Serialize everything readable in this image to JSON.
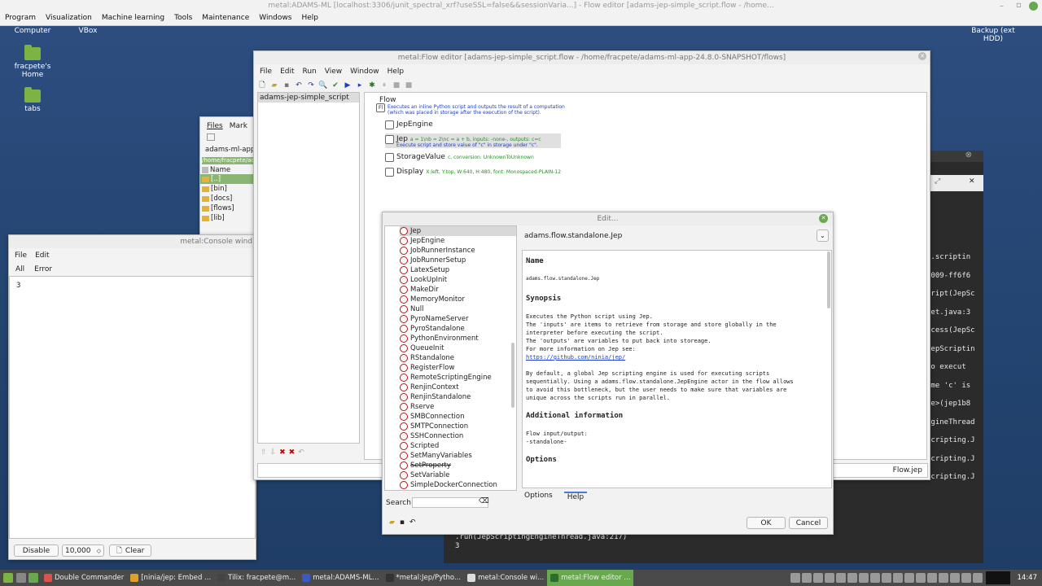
{
  "appbar": {
    "title": "metal:ADAMS-ML [localhost:3306/junit_spectral_xrf?useSSL=false&&sessionVaria...] - Flow editor [adams-jep-simple_script.flow - /home...",
    "menu": [
      "Program",
      "Visualization",
      "Machine learning",
      "Tools",
      "Maintenance",
      "Windows",
      "Help"
    ]
  },
  "desktop": {
    "computer": "Computer",
    "vbox": "VBox",
    "backup": "Backup (ext",
    "backup2": "HDD)",
    "home_line1": "fracpete's",
    "home_line2": "Home",
    "tabs": "tabs"
  },
  "console": {
    "title": "metal:Console wind",
    "menu": [
      "File",
      "Edit"
    ],
    "tabs": [
      "All",
      "Error"
    ],
    "content": "3",
    "disable": "Disable",
    "spinner": "10,000",
    "clear": "Clear"
  },
  "filesmgr": {
    "tabs": [
      "Files",
      "Mark"
    ],
    "path_label": "adams-ml-app-2",
    "path_field": "/home/fracpete/ad",
    "name_header": "Name",
    "items": [
      "[..]",
      "[bin]",
      "[docs]",
      "[flows]",
      "[lib]"
    ]
  },
  "flow": {
    "title": "metal:Flow editor [adams-jep-simple_script.flow - /home/fracpete/adams-ml-app-24.8.0-SNAPSHOT/flows]",
    "menu": [
      "File",
      "Edit",
      "Run",
      "View",
      "Window",
      "Help"
    ],
    "tab": "adams-jep-simple_script",
    "root_label": "Flow",
    "root_desc1": "Executes an inline Python script and outputs the result of a computation",
    "root_desc2": "(which was placed in storage after the execution of the script).",
    "nodes": [
      {
        "name": "JepEngine",
        "icon": "jep",
        "desc1": "",
        "desc2": ""
      },
      {
        "name": "Jep",
        "icon": "jep",
        "desc1": "a = 1\\nb = 2\\nc = a + b, inputs: -none-, outputs: c=c",
        "desc2": "Execute script and store value of \"c\" in storage under \"c\"."
      },
      {
        "name": "StorageValue",
        "icon": "sv",
        "desc1": "c, conversion: UnknownToUnknown",
        "desc2": ""
      },
      {
        "name": "Display",
        "icon": "disp",
        "desc1": "X:left, Y:top, W:640, H:480, font: Monospaced-PLAIN-12",
        "desc2": ""
      }
    ],
    "status": "Flow.jep"
  },
  "edit": {
    "title": "Edit...",
    "class": "adams.flow.standalone.Jep",
    "actors": [
      "Jep",
      "JepEngine",
      "JobRunnerInstance",
      "JobRunnerSetup",
      "LatexSetup",
      "LookUpInit",
      "MakeDir",
      "MemoryMonitor",
      "Null",
      "PyroNameServer",
      "PyroStandalone",
      "PythonEnvironment",
      "QueueInit",
      "RStandalone",
      "RegisterFlow",
      "RemoteScriptingEngine",
      "RenjinContext",
      "RenjinStandalone",
      "Rserve",
      "SMBConnection",
      "SMTPConnection",
      "SSHConnection",
      "Scripted",
      "SetManyVariables",
      "SetProperty",
      "SetVariable",
      "SimpleDockerConnection"
    ],
    "search_label": "Search",
    "help_name_h": "Name",
    "help_name": "adams.flow.standalone.Jep",
    "help_syn_h": "Synopsis",
    "help_syn": [
      "Executes the Python script using Jep.",
      "The 'inputs' are items to retrieve from storage and store globally in the",
      "interpreter before executing the script.",
      "The 'outputs' are variables to put back into storeage.",
      "For more information on Jep see:"
    ],
    "help_link": "https://github.com/ninia/jep/",
    "help_default": [
      "By default, a global Jep scripting engine is used for executing scripts",
      "sequentially. Using a adams.flow.standalone.JepEngine actor in the flow allows",
      "to avoid this bottleneck, but the user needs to make sure that variables are",
      "unique across the scripts run in parallel."
    ],
    "help_add_h": "Additional information",
    "help_add": [
      "Flow input/output:",
      "-standalone-"
    ],
    "help_opt_h": "Options",
    "tabs": [
      "Options",
      "Help"
    ],
    "ok": "OK",
    "cancel": "Cancel"
  },
  "terminal": {
    "right_lines": [
      "e.scriptin",
      "2009-ff6f6",
      "cript(JepSc",
      "let.java:3",
      "ocess(JepSc",
      "JepScriptin",
      "to execut",
      "ame 'c' is",
      "le>(jep1b8",
      "ngineThread",
      "scripting.JepScriptlet.execute(Jep",
      "scripting.JepScriptingEngineThread",
      "scripting.JepScriptingEngineThread"
    ],
    "bottom_lines": [
      ".run(JepScriptingEngineThread.java:217)",
      "3"
    ]
  },
  "taskbar": {
    "tasks": [
      {
        "label": "Double Commander",
        "color": "#d9534f"
      },
      {
        "label": "[ninia/jep: Embed ...",
        "color": "#e0a030"
      },
      {
        "label": "Tilix: fracpete@m...",
        "color": "#444444"
      },
      {
        "label": "metal:ADAMS-ML...",
        "color": "#3a5bbf"
      },
      {
        "label": "*metal:Jep/Pytho...",
        "color": "#333333"
      },
      {
        "label": "metal:Console wi...",
        "color": "#dddddd"
      },
      {
        "label": "metal:Flow editor ...",
        "color": "#2b6e2b"
      }
    ],
    "clock": "14:47"
  }
}
